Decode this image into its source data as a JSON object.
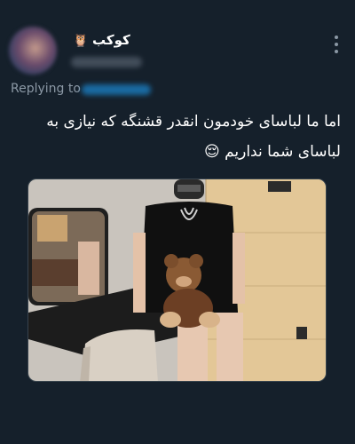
{
  "author": {
    "display_name": "کوکب",
    "name_emoji": "🦉",
    "avatar_icon": "avatar-blurred"
  },
  "reply": {
    "label": "Replying to"
  },
  "tweet": {
    "line1": "اما ما لباسای خودمون انقدر قشنگه که نیازی به",
    "line2": "لباسای شما نداریم 😌"
  },
  "media": {
    "description_icon": "photo"
  },
  "colors": {
    "background": "#15202b",
    "text": "#ffffff",
    "secondary": "#8b98a5",
    "accent": "#1d9bf0"
  }
}
